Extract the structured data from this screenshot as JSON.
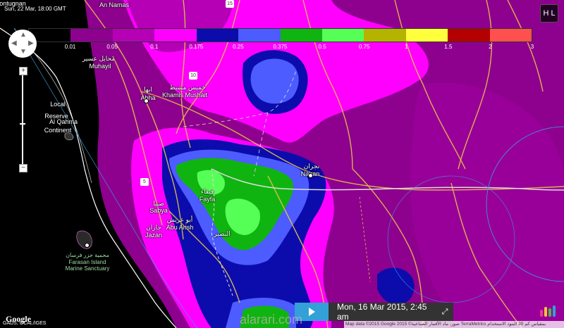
{
  "timestamp_top": "Sun, 22 Mar, 18:00 GMT",
  "top_left_label": "ontugnan",
  "hl_button_label": "H L",
  "legend": [
    {
      "label": "0.01",
      "color": "#000000"
    },
    {
      "label": "0.05",
      "color": "#8e008e"
    },
    {
      "label": "0.1",
      "color": "#b600b6"
    },
    {
      "label": "0.175",
      "color": "#ff00ff"
    },
    {
      "label": "0.25",
      "color": "#0c0cad"
    },
    {
      "label": "0.375",
      "color": "#4c5cff"
    },
    {
      "label": "0.5",
      "color": "#10b410"
    },
    {
      "label": "0.75",
      "color": "#56ff56"
    },
    {
      "label": "1",
      "color": "#b4b400"
    },
    {
      "label": "1.5",
      "color": "#ffff3c"
    },
    {
      "label": "2",
      "color": "#b40000"
    },
    {
      "label": "3",
      "color": "#ff5050"
    }
  ],
  "places": {
    "an_namas": "An Namas",
    "muhayil_ar": "محايل عسير",
    "muhayil": "Muhayil",
    "abha_ar": "ابها",
    "abha": "Abha",
    "khamis_ar": "خميس مشيط",
    "khamis": "Khamis Mushait",
    "local": "Local",
    "reserve": "Reserve",
    "alqahma": "Al Qahma",
    "continent": "Continent",
    "najran_ar": "نجران",
    "najran": "Najran",
    "faifa_ar": "فيفاء",
    "faifa": "Fayfa",
    "sabya_ar": "صبيا",
    "sabya": "Sabya",
    "abuarish_ar": "أبو عريش",
    "abuarish": "Abu Arish",
    "jazan_ar": "جازان",
    "jazan": "Jazan",
    "farasan_ar": "محمية جزر فرسان",
    "farasan1": "Farasan Island",
    "farasan2": "Marine Sanctuary",
    "alqahma_ar": "مجمية جزر",
    "albayda_ar": "البصير"
  },
  "road_shields": {
    "r10": "10",
    "r5": "5",
    "r15": "15"
  },
  "playbar": {
    "date": "Mon, 16 Mar 2015, 2:45 am"
  },
  "watermark": "alarari.com",
  "google": "Google",
  "credit_left": "GADS, OCAL/IGES",
  "attribution": "Map data ©2015 Google 2015 ©صور، ماد الأقمار الصناعية TerraMetrics بمقياس كم 20 البنود الاستخدام"
}
